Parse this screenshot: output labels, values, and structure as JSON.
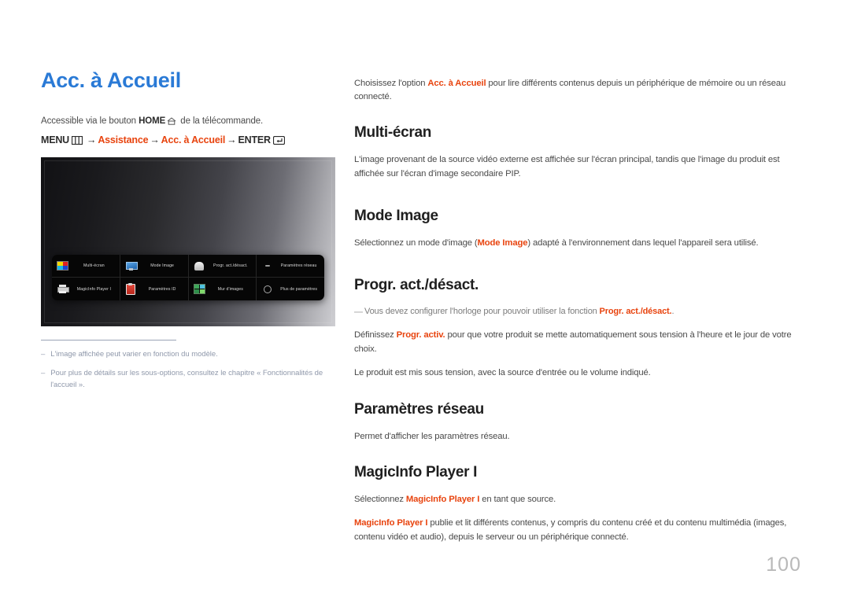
{
  "page": {
    "title": "Acc. à Accueil",
    "number": "100",
    "title_color": "#2a7ad6",
    "accent_color": "#e8440f"
  },
  "left": {
    "access_text_before": "Accessible via le bouton ",
    "access_bold": "HOME",
    "access_text_after": " de la télécommande.",
    "menu_path": {
      "menu_label": "MENU",
      "arrow": "→",
      "step1": "Assistance",
      "step2": "Acc. à Accueil",
      "enter_label": "ENTER"
    },
    "footnotes": [
      {
        "dash": "–",
        "text": "L'image affichée peut varier en fonction du modèle."
      },
      {
        "dash": "–",
        "text": "Pour plus de détails sur les sous-options, consultez le chapitre « Fonctionnalités de l'accueil »."
      }
    ]
  },
  "tv_home_menu": {
    "row1": [
      {
        "label": "Multi-écran",
        "icon": "color-quadrant-icon"
      },
      {
        "label": "Mode Image",
        "icon": "monitor-icon"
      },
      {
        "label": "Progr. act./désact.",
        "icon": "dome-timer-icon"
      },
      {
        "label": "Paramètres réseau",
        "icon": "network-dash-icon"
      }
    ],
    "row2": [
      {
        "label": "MagicInfo Player I",
        "icon": "player-device-icon"
      },
      {
        "label": "Paramètres ID",
        "icon": "clipboard-id-icon"
      },
      {
        "label": "Mur d'images",
        "icon": "video-wall-icon"
      },
      {
        "label": "Plus de paramètres",
        "icon": "more-settings-icon"
      }
    ]
  },
  "right": {
    "intro": {
      "before": "Choisissez l'option ",
      "highlight": "Acc. à Accueil",
      "after": " pour lire différents contenus depuis un périphérique de mémoire ou un réseau connecté."
    },
    "sections": [
      {
        "heading": "Multi-écran",
        "paragraph": "L'image provenant de la source vidéo externe est affichée sur l'écran principal, tandis que l'image du produit est affichée sur l'écran d'image secondaire PIP."
      },
      {
        "heading": "Mode Image",
        "p_before": "Sélectionnez un mode d'image (",
        "p_highlight": "Mode Image",
        "p_after": ") adapté à l'environnement dans lequel l'appareil sera utilisé."
      },
      {
        "heading": "Progr. act./désact.",
        "note_dash": "—",
        "note_before": "Vous devez configurer l'horloge pour pouvoir utiliser la fonction ",
        "note_highlight": "Progr. act./désact.",
        "note_after": ".",
        "p2_before": "Définissez ",
        "p2_highlight": "Progr. activ.",
        "p2_after": " pour que votre produit se mette automatiquement sous tension à l'heure et le jour de votre choix.",
        "p3": "Le produit est mis sous tension, avec la source d'entrée ou le volume indiqué."
      },
      {
        "heading": "Paramètres réseau",
        "paragraph": "Permet d'afficher les paramètres réseau."
      },
      {
        "heading": "MagicInfo Player I",
        "p1_before": "Sélectionnez ",
        "p1_highlight": "MagicInfo Player I",
        "p1_after": " en tant que source.",
        "p2_highlight": "MagicInfo Player I",
        "p2_after": " publie et lit différents contenus, y compris du contenu créé et du contenu multimédia (images, contenu vidéo et audio), depuis le serveur ou un périphérique connecté."
      }
    ]
  }
}
